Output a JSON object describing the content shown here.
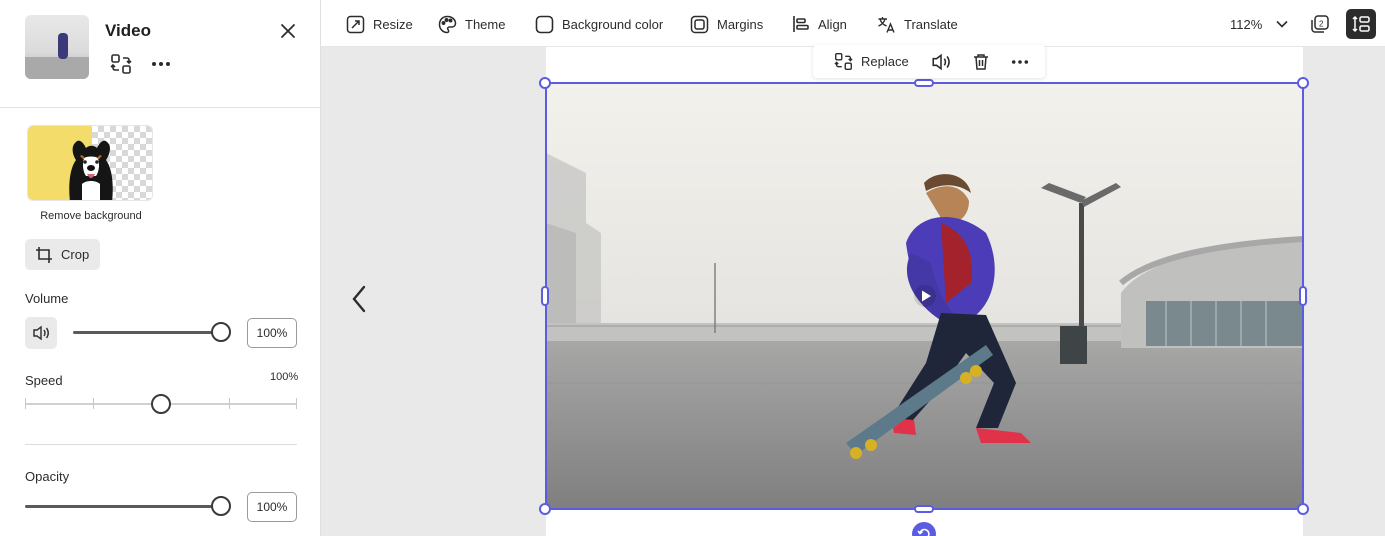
{
  "panel": {
    "title": "Video",
    "remove_background_label": "Remove background",
    "crop_label": "Crop",
    "volume": {
      "label": "Volume",
      "value": "100%",
      "level": 1.0
    },
    "speed": {
      "label": "Speed",
      "value": "100%",
      "level": 0.5
    },
    "opacity": {
      "label": "Opacity",
      "value": "100%",
      "level": 1.0
    }
  },
  "toolbar": {
    "resize": "Resize",
    "theme": "Theme",
    "background_color": "Background color",
    "margins": "Margins",
    "align": "Align",
    "translate": "Translate",
    "zoom": "112%"
  },
  "context_bar": {
    "replace": "Replace"
  },
  "colors": {
    "selection": "#5c5ce0",
    "rb_yellow": "#f4dc6b",
    "canvas_bg": "#e9e9e9"
  }
}
